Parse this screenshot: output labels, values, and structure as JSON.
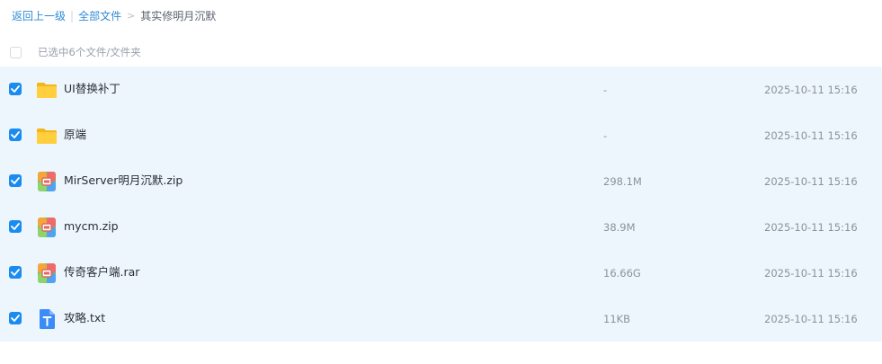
{
  "breadcrumb": {
    "back": "返回上一级",
    "divider": "|",
    "all_files": "全部文件",
    "separator": ">",
    "current": "其实修明月沉默"
  },
  "selection": {
    "summary": "已选中6个文件/文件夹"
  },
  "files": [
    {
      "name": "UI替换补丁",
      "size": "-",
      "modified": "2025-10-11 15:16",
      "icon": "folder-icon",
      "selected": true
    },
    {
      "name": "原端",
      "size": "-",
      "modified": "2025-10-11 15:16",
      "icon": "folder-icon",
      "selected": true
    },
    {
      "name": "MirServer明月沉默.zip",
      "size": "298.1M",
      "modified": "2025-10-11 15:16",
      "icon": "archive-icon",
      "selected": true
    },
    {
      "name": "mycm.zip",
      "size": "38.9M",
      "modified": "2025-10-11 15:16",
      "icon": "archive-icon",
      "selected": true
    },
    {
      "name": "传奇客户端.rar",
      "size": "16.66G",
      "modified": "2025-10-11 15:16",
      "icon": "archive-icon",
      "selected": true
    },
    {
      "name": "攻略.txt",
      "size": "11KB",
      "modified": "2025-10-11 15:16",
      "icon": "text-file-icon",
      "selected": true
    }
  ],
  "colors": {
    "accent": "#1a8cf0",
    "link": "#2f8bd6",
    "selected_row_bg": "#eef6fd",
    "folder": "#ffc529",
    "text_file": "#3b8cf6"
  }
}
